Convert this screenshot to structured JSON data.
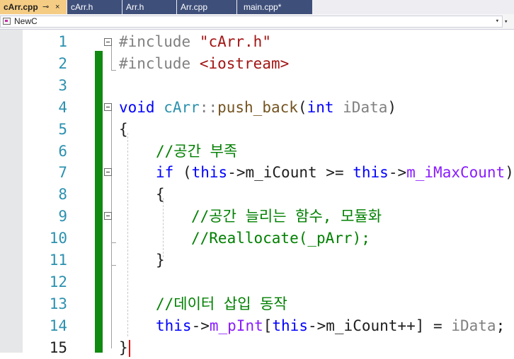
{
  "tabs": [
    {
      "label": "cArr.cpp",
      "active": true,
      "pin": "⊸",
      "close": "×"
    },
    {
      "label": "cArr.h"
    },
    {
      "label": "Arr.h"
    },
    {
      "label": "Arr.cpp"
    },
    {
      "label": "main.cpp*"
    }
  ],
  "nav": {
    "scope": "NewC",
    "dropdown": "▾",
    "split": "▾"
  },
  "line_numbers": [
    "1",
    "2",
    "3",
    "4",
    "5",
    "6",
    "7",
    "8",
    "9",
    "10",
    "11",
    "12",
    "13",
    "14",
    "15"
  ],
  "current_line": "15",
  "code": {
    "l1": {
      "directive": "#include",
      "header": "\"cArr.h\""
    },
    "l2": {
      "directive": "#include",
      "header": "<iostream>"
    },
    "l4": {
      "void": "void",
      "class": "cArr",
      "scope": "::",
      "func": "push_back",
      "open": "(",
      "type": "int",
      "param": "iData",
      "close": ")"
    },
    "l5": "{",
    "l6": "//공간 부족",
    "l7": {
      "kw_if": "if",
      "open": "(",
      "this1": "this",
      "arrow1": "->",
      "count": "m_iCount",
      "op": ">=",
      "this2": "this",
      "arrow2": "->",
      "max": "m_iMaxCount",
      "close": ")"
    },
    "l8": "{",
    "l9": "//공간 늘리는 함수, 모듈화",
    "l10": "//Reallocate(_pArr);",
    "l11": "}",
    "l13": "//데이터 삽입 동작",
    "l14": {
      "this1": "this",
      "arrow1": "->",
      "ptr": "m_pInt",
      "lbr": "[",
      "this2": "this",
      "arrow2": "->",
      "count": "m_iCount",
      "inc": "++",
      "rbr": "]",
      "assign": "=",
      "param": "iData",
      "semi": ";"
    },
    "l15": "}"
  },
  "colors": {
    "change_bar": "#108a10",
    "active_tab": "#f5cc84",
    "inactive_tab": "#3e4f7a",
    "line_number": "#2b91af"
  }
}
